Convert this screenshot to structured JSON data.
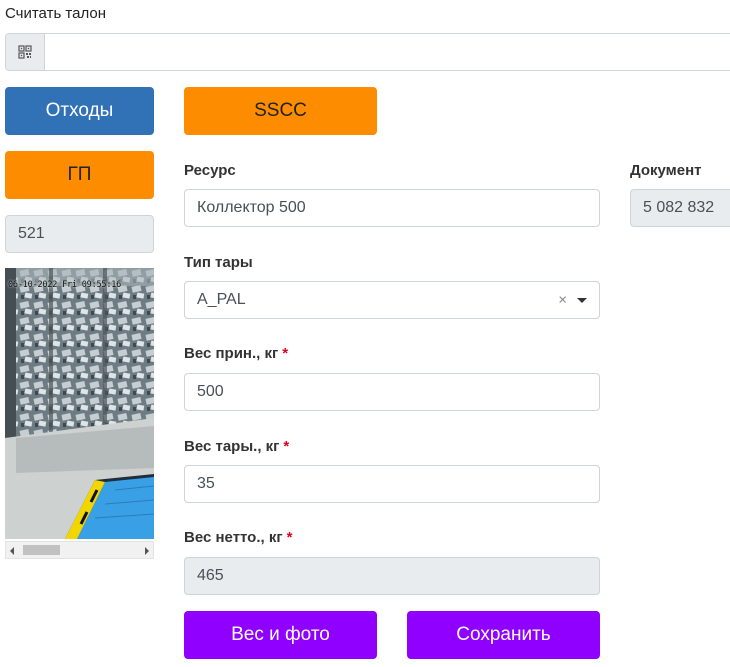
{
  "scan": {
    "label": "Считать талон",
    "icon": "qr-code-icon",
    "value": "",
    "placeholder": ""
  },
  "left": {
    "waste_button": "Отходы",
    "gp_button": "ГП",
    "counter_value": "521",
    "camera": {
      "timestamp": "06-10-2022 Fri 09:55:16"
    }
  },
  "form": {
    "sscc_button": "SSCC",
    "resource": {
      "label": "Ресурс",
      "value": "Коллектор 500"
    },
    "document": {
      "label": "Документ",
      "value": "5 082 832"
    },
    "tare_type": {
      "label": "Тип тары",
      "value": "A_PAL",
      "clear": "×"
    },
    "gross_weight": {
      "label": "Вес прин., кг",
      "required": "*",
      "value": "500"
    },
    "tare_weight": {
      "label": "Вес тары., кг",
      "required": "*",
      "value": "35"
    },
    "net_weight": {
      "label": "Вес нетто., кг",
      "required": "*",
      "value": "465"
    },
    "weigh_photo_button": "Вес и фото",
    "save_button": "Сохранить"
  },
  "colors": {
    "blue": "#3171b5",
    "orange": "#fd8c00",
    "purple": "#8f00ff",
    "required": "#e0001b"
  }
}
